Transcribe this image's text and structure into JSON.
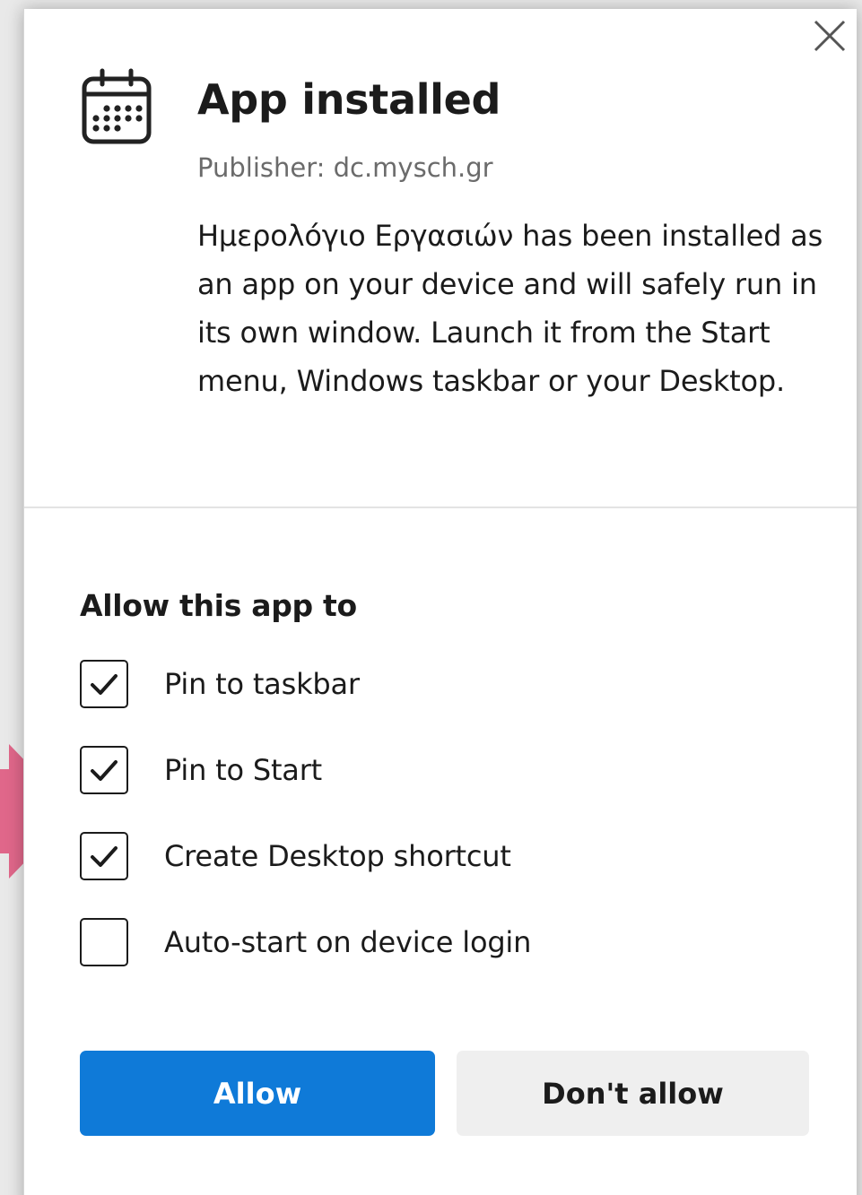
{
  "dialog": {
    "title": "App installed",
    "publisher": "Publisher: dc.mysch.gr",
    "message": "Ημερολόγιο Εργασιών has been installed as an app on your device and will safely run in its own window. Launch it from the Start menu, Windows taskbar or your Desktop.",
    "app_icon": "calendar-icon",
    "close_icon": "close-icon"
  },
  "permissions": {
    "heading": "Allow this app to",
    "options": [
      {
        "label": "Pin to taskbar",
        "checked": true
      },
      {
        "label": "Pin to Start",
        "checked": true
      },
      {
        "label": "Create Desktop shortcut",
        "checked": true
      },
      {
        "label": "Auto-start on device login",
        "checked": false
      }
    ]
  },
  "buttons": {
    "allow": "Allow",
    "deny": "Don't allow"
  },
  "colors": {
    "primary": "#0f7ad8",
    "secondary_button": "#efefef",
    "annotation_arrow": "#e0678a"
  }
}
